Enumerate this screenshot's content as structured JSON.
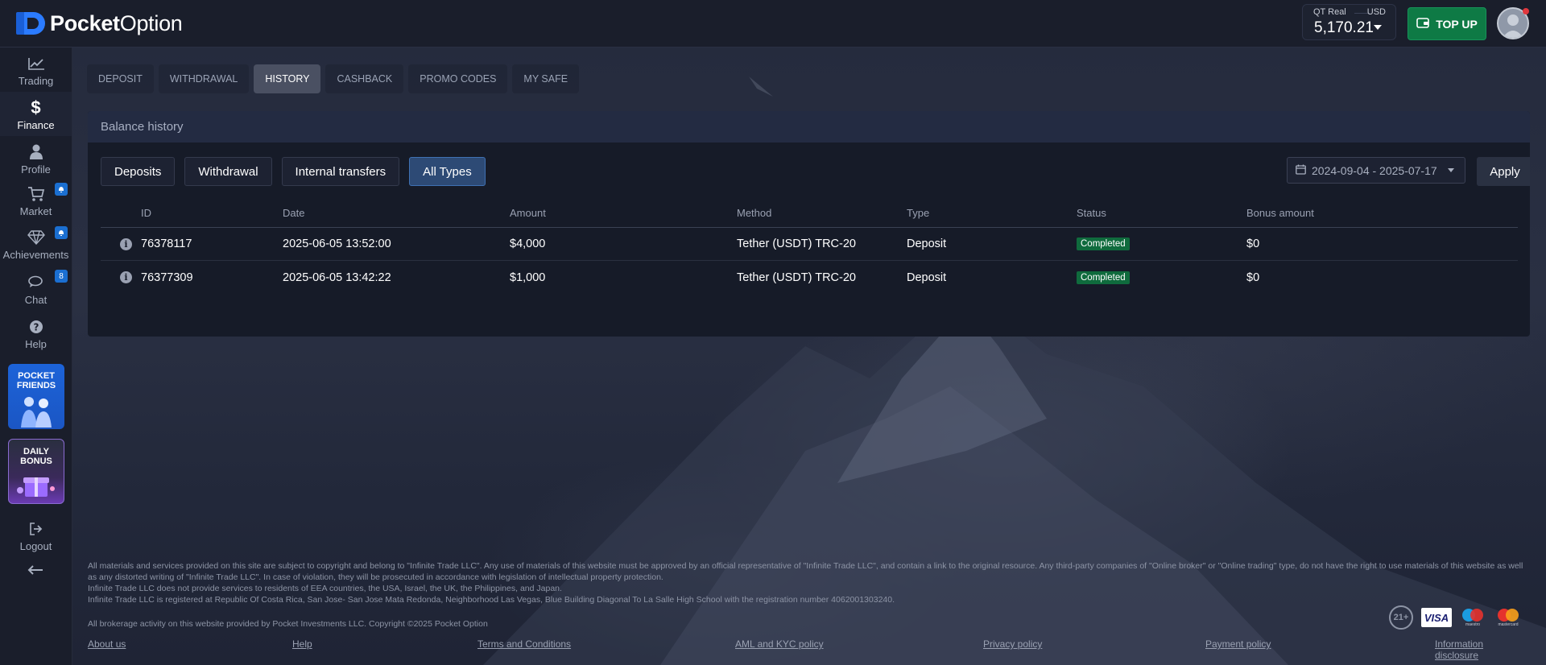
{
  "brand": {
    "name_bold": "Pocket",
    "name_regular": "Option"
  },
  "account": {
    "type": "QT Real",
    "currency": "USD",
    "balance": "5,170.21"
  },
  "topup_label": "TOP UP",
  "sidebar": {
    "items": [
      {
        "label": "Trading",
        "icon": "chart-line-icon"
      },
      {
        "label": "Finance",
        "icon": "dollar-icon"
      },
      {
        "label": "Profile",
        "icon": "user-icon"
      },
      {
        "label": "Market",
        "icon": "cart-icon"
      },
      {
        "label": "Achievements",
        "icon": "diamond-icon"
      },
      {
        "label": "Chat",
        "icon": "chat-icon",
        "badge": "8"
      },
      {
        "label": "Help",
        "icon": "question-icon"
      },
      {
        "label": "Logout",
        "icon": "logout-icon"
      }
    ],
    "promo_friends": "POCKET FRIENDS",
    "promo_bonus": "DAILY BONUS"
  },
  "tabs": [
    "DEPOSIT",
    "WITHDRAWAL",
    "HISTORY",
    "CASHBACK",
    "PROMO CODES",
    "MY SAFE"
  ],
  "active_tab": "HISTORY",
  "panel_title": "Balance history",
  "filters": [
    "Deposits",
    "Withdrawal",
    "Internal transfers",
    "All Types"
  ],
  "active_filter": "All Types",
  "date_range": "2024-09-04 - 2025-07-17",
  "apply_label": "Apply",
  "table": {
    "headers": [
      "ID",
      "Date",
      "Amount",
      "Method",
      "Type",
      "Status",
      "Bonus amount"
    ],
    "rows": [
      {
        "id": "76378117",
        "date": "2025-06-05 13:52:00",
        "amount": "$4,000",
        "method": "Tether (USDT) TRC-20",
        "type": "Deposit",
        "status": "Completed",
        "bonus": "$0"
      },
      {
        "id": "76377309",
        "date": "2025-06-05 13:42:22",
        "amount": "$1,000",
        "method": "Tether (USDT) TRC-20",
        "type": "Deposit",
        "status": "Completed",
        "bonus": "$0"
      }
    ]
  },
  "footer": {
    "line1": "All materials and services provided on this site are subject to copyright and belong to \"Infinite Trade LLC\". Any use of materials of this website must be approved by an official representative of \"Infinite Trade LLC\", and contain a link to the original resource. Any third-party companies of \"Online broker\" or \"Online trading\" type, do not have the right to use materials of this website as well as any distorted writing of \"Infinite Trade LLC\". In case of violation, they will be prosecuted in accordance with legislation of intellectual property protection.",
    "line2": "Infinite Trade LLC does not provide services to residents of EEA countries, the USA, Israel, the UK, the Philippines, and Japan.",
    "line3": "Infinite Trade LLC is registered at Republic Of Costa Rica, San Jose- San Jose Mata Redonda, Neighborhood Las Vegas, Blue Building Diagonal To La Salle High School with the registration number 4062001303240.",
    "copyright": "All brokerage activity on this website provided by Pocket Investments LLC. Copyright ©2025 Pocket Option",
    "links": [
      "About us",
      "Help",
      "Terms and Conditions",
      "AML and KYC policy",
      "Privacy policy",
      "Payment policy",
      "Information disclosure"
    ],
    "age": "21+",
    "visa": "VISA",
    "maestro": "maestro",
    "mastercard": "mastercard"
  },
  "colors": {
    "accent_green": "#0e7a45",
    "status_green": "#0f6b3d",
    "brand_blue": "#1b6fd1"
  }
}
